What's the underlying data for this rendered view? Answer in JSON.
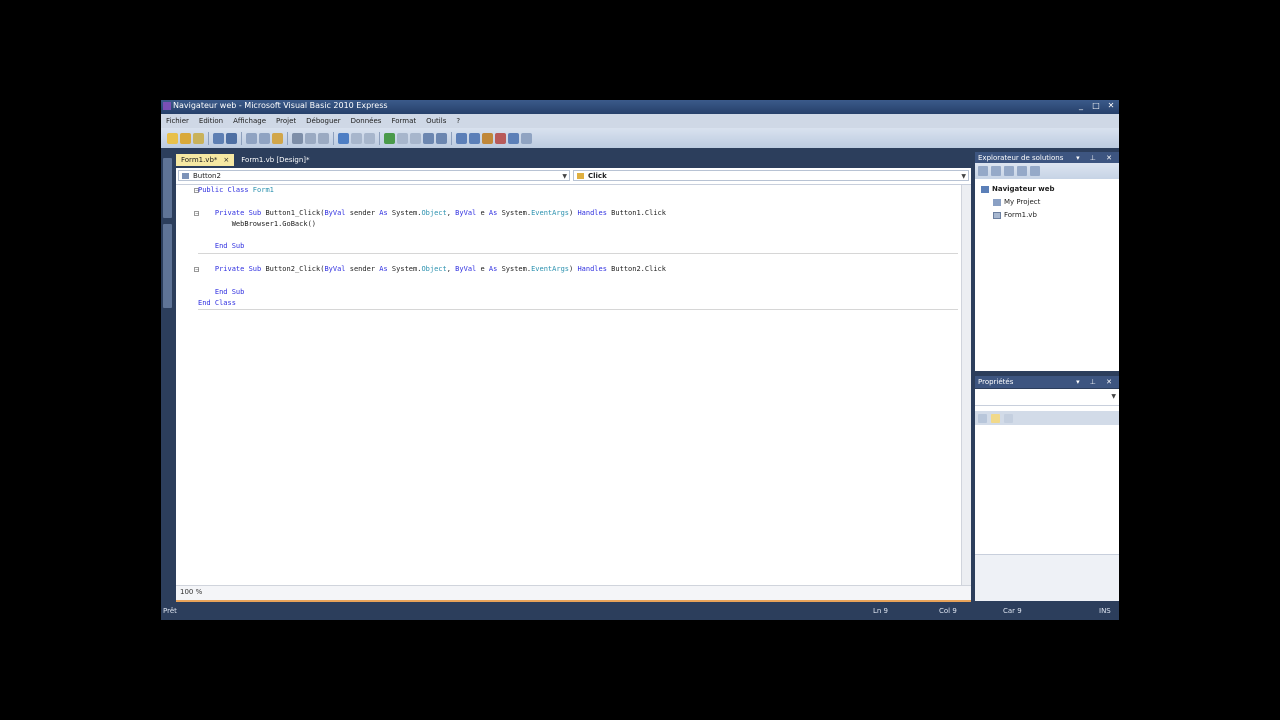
{
  "window": {
    "title": "Navigateur web - Microsoft Visual Basic 2010 Express",
    "controls": [
      "_",
      "□",
      "✕"
    ]
  },
  "menu": [
    "Fichier",
    "Edition",
    "Affichage",
    "Projet",
    "Déboguer",
    "Données",
    "Format",
    "Outils",
    "?"
  ],
  "doc_tabs": [
    {
      "label": "Form1.vb*",
      "close": "×",
      "active": true
    },
    {
      "label": "Form1.vb [Design]*",
      "active": false
    }
  ],
  "editor": {
    "object_combo": "Button2",
    "event_combo": "Click",
    "zoom": "100 %",
    "code": [
      {
        "parts": [
          [
            "kw",
            "Public Class "
          ],
          [
            "ty",
            "Form1"
          ]
        ]
      },
      {
        "parts": []
      },
      {
        "parts": [
          [
            "",
            "    "
          ],
          [
            "kw",
            "Private Sub "
          ],
          [
            "",
            "Button1_Click("
          ],
          [
            "kw",
            "ByVal "
          ],
          [
            "",
            "sender "
          ],
          [
            "kw",
            "As "
          ],
          [
            "",
            "System."
          ],
          [
            "ty",
            "Object"
          ],
          [
            "",
            ", "
          ],
          [
            "kw",
            "ByVal "
          ],
          [
            "",
            "e "
          ],
          [
            "kw",
            "As "
          ],
          [
            "",
            "System."
          ],
          [
            "ty",
            "EventArgs"
          ],
          [
            "",
            ") "
          ],
          [
            "kw",
            "Handles "
          ],
          [
            "",
            "Button1.Click"
          ]
        ]
      },
      {
        "parts": [
          [
            "",
            "        WebBrowser1.GoBack()"
          ]
        ]
      },
      {
        "parts": []
      },
      {
        "parts": [
          [
            "",
            "    "
          ],
          [
            "kw",
            "End Sub"
          ]
        ]
      },
      {
        "parts": []
      },
      {
        "parts": [
          [
            "",
            "    "
          ],
          [
            "kw",
            "Private Sub "
          ],
          [
            "",
            "Button2_Click("
          ],
          [
            "kw",
            "ByVal "
          ],
          [
            "",
            "sender "
          ],
          [
            "kw",
            "As "
          ],
          [
            "",
            "System."
          ],
          [
            "ty",
            "Object"
          ],
          [
            "",
            ", "
          ],
          [
            "kw",
            "ByVal "
          ],
          [
            "",
            "e "
          ],
          [
            "kw",
            "As "
          ],
          [
            "",
            "System."
          ],
          [
            "ty",
            "EventArgs"
          ],
          [
            "",
            ") "
          ],
          [
            "kw",
            "Handles "
          ],
          [
            "",
            "Button2.Click"
          ]
        ]
      },
      {
        "parts": []
      },
      {
        "parts": [
          [
            "",
            "    "
          ],
          [
            "kw",
            "End Sub"
          ]
        ]
      },
      {
        "parts": [
          [
            "kw",
            "End Class"
          ]
        ]
      }
    ]
  },
  "solution_explorer": {
    "title": "Explorateur de solutions",
    "controls": "▾ ⊥ ✕",
    "items": [
      "Navigateur web",
      "My Project",
      "Form1.vb"
    ]
  },
  "properties": {
    "title": "Propriétés",
    "controls": "▾ ⊥ ✕"
  },
  "status": {
    "ready": "Prêt",
    "line": "Ln 9",
    "col": "Col 9",
    "ch": "Car 9",
    "mode": "INS"
  },
  "colors": {
    "frame": "#2c3e5c",
    "active_tab": "#f6e8a3",
    "keyword": "#3030e0",
    "type": "#2b91af"
  }
}
